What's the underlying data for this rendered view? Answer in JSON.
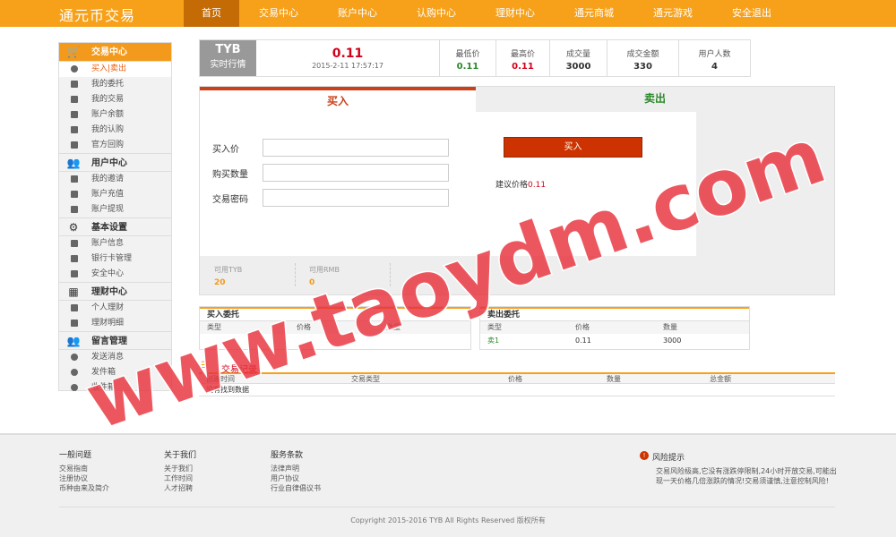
{
  "header": {
    "logo": "通元币交易",
    "nav": [
      "首页",
      "交易中心",
      "账户中心",
      "认购中心",
      "理财中心",
      "通元商城",
      "通元游戏",
      "安全退出"
    ]
  },
  "sidebar": {
    "groups": [
      {
        "title": "交易中心",
        "items": [
          "买入|卖出",
          "我的委托",
          "我的交易",
          "账户余额",
          "我的认购",
          "官方回购"
        ]
      },
      {
        "title": "用户中心",
        "items": [
          "我的邀请",
          "账户充值",
          "账户提现"
        ]
      },
      {
        "title": "基本设置",
        "items": [
          "账户信息",
          "银行卡管理",
          "安全中心"
        ]
      },
      {
        "title": "理财中心",
        "items": [
          "个人理财",
          "理财明细"
        ]
      },
      {
        "title": "留言管理",
        "items": [
          "发送消息",
          "发件箱",
          "收件箱"
        ]
      }
    ]
  },
  "ticker": {
    "symbol": "TYB",
    "label": "实时行情",
    "price": "0.11",
    "datetime": "2015-2-11 17:57:17",
    "stats": [
      {
        "label": "最低价",
        "value": "0.11",
        "color": "#2a8a2a"
      },
      {
        "label": "最高价",
        "value": "0.11",
        "color": "#d0021b"
      },
      {
        "label": "成交量",
        "value": "3000",
        "color": "#222222"
      },
      {
        "label": "成交金额",
        "value": "330",
        "color": "#222222"
      },
      {
        "label": "用户人数",
        "value": "4",
        "color": "#222222"
      }
    ]
  },
  "trade": {
    "tab_buy": "买入",
    "tab_sell": "卖出",
    "price_label": "买入价",
    "qty_label": "购买数量",
    "pwd_label": "交易密码",
    "buy_button": "买入",
    "suggest_label": "建议价格",
    "suggest_price": "0.11",
    "avail_tyb_label": "可用TYB",
    "avail_tyb": "20",
    "avail_rmb_label": "可用RMB",
    "avail_rmb": "0"
  },
  "buy_orders": {
    "title": "买入委托",
    "columns": [
      "类型",
      "价格",
      "数量"
    ],
    "rows": []
  },
  "sell_orders": {
    "title": "卖出委托",
    "columns": [
      "类型",
      "价格",
      "数量"
    ],
    "rows": [
      [
        "卖1",
        "0.11",
        "3000"
      ]
    ]
  },
  "records": {
    "title": "交易记录",
    "columns": [
      "创建时间",
      "交易类型",
      "价格",
      "数量",
      "总金额"
    ],
    "empty": "没有找到数据"
  },
  "footer": {
    "cols": [
      {
        "title": "一般问题",
        "links": [
          "交易指南",
          "注册协议",
          "币种由来及简介"
        ]
      },
      {
        "title": "关于我们",
        "links": [
          "关于我们",
          "工作时间",
          "人才招聘"
        ]
      },
      {
        "title": "服务条款",
        "links": [
          "法律声明",
          "用户协议",
          "行业自律倡议书"
        ]
      }
    ],
    "risk_title": "风险提示",
    "risk_text": "交易风险极高,它没有涨跌停限制,24小时开放交易,可能出现一天价格几倍涨跌的情况!交易须谨慎,注意控制风险!",
    "copyright": "Copyright 2015-2016 TYB All Rights Reserved 版权所有"
  },
  "watermark": "www.taoydm.com",
  "colors": {
    "brand": "#f7a11a",
    "buy": "#cc3300",
    "sell": "#2a8a2a",
    "watermark": "#e8323c"
  }
}
